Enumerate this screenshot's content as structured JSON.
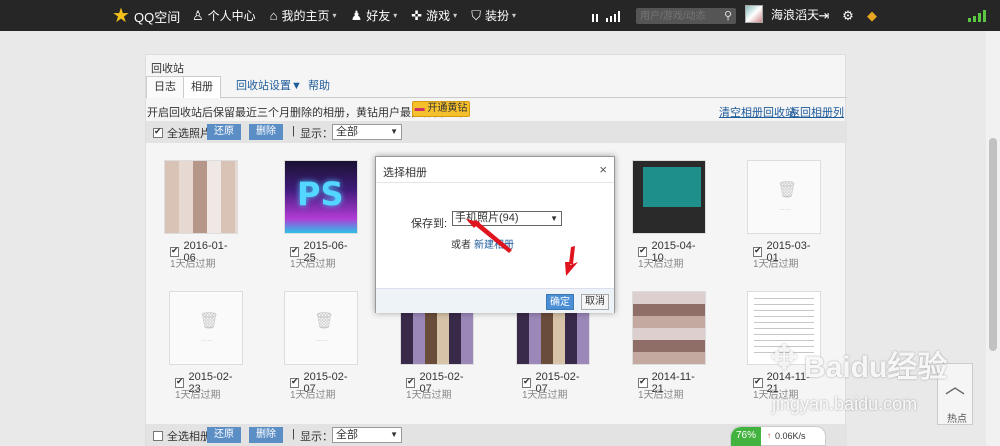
{
  "topbar": {
    "logo_text": "QQ空间",
    "nav": [
      {
        "label": "个人中心",
        "icon": "person-icon",
        "caret": false
      },
      {
        "label": "我的主页",
        "icon": "home-icon",
        "caret": true
      },
      {
        "label": "好友",
        "icon": "friends-icon",
        "caret": true
      },
      {
        "label": "游戏",
        "icon": "gamepad-icon",
        "caret": true
      },
      {
        "label": "装扮",
        "icon": "shirt-icon",
        "caret": true
      }
    ],
    "search_placeholder": "用户/游戏/动态",
    "username": "海浪滔天",
    "caret": "▾"
  },
  "panel": {
    "title": "回收站",
    "tabs": [
      "日志",
      "相册",
      "回收站设置▼",
      "帮助"
    ],
    "info_text": "开启回收站后保留最近三个月删除的相册，黄钻用户最多保留一年",
    "vip_button": "开通黄钻",
    "clear_link": "清空相册回收站",
    "back_link": "返回相册列表"
  },
  "toolbar": {
    "select_all_photos": "全选照片",
    "restore": "还原",
    "delete": "删除",
    "display_label": "显示：",
    "display_value": "全部"
  },
  "toolbar_bottom": {
    "select_all_albums": "全选相册",
    "restore": "还原",
    "delete": "删除",
    "display_label": "显示：",
    "display_value": "全部"
  },
  "photos": [
    {
      "date": "2016-01-06",
      "expire": "1天后过期"
    },
    {
      "date": "2015-06-25",
      "expire": "1天后过期"
    },
    {
      "date": "2015-04-10",
      "expire": "1天后过期"
    },
    {
      "date": "2015-03-01",
      "expire": "1天后过期"
    },
    {
      "date": "2015-02-23",
      "expire": "1天后过期"
    },
    {
      "date": "2015-02-07",
      "expire": "1天后过期"
    },
    {
      "date": "2015-02-07",
      "expire": "1天后过期"
    },
    {
      "date": "2015-02-07",
      "expire": "1天后过期"
    },
    {
      "date": "2014-11-21",
      "expire": "1天后过期"
    },
    {
      "date": "2014-11-21",
      "expire": "1天后过期"
    }
  ],
  "dialog": {
    "title": "选择相册",
    "close": "×",
    "save_label": "保存到:",
    "save_value": "手机照片(94)",
    "or_text": "或者",
    "new_album": "新建相册",
    "ok": "确定",
    "cancel": "取消"
  },
  "widgets": {
    "hot_label": "热点",
    "percent": "76%",
    "net_speed": "0.06K/s"
  },
  "watermark": {
    "brand": "Baidu经验",
    "url": "jingyan.baidu.com"
  },
  "colors": {
    "topbar": "#262626",
    "accent_blue": "#5b8ec5",
    "vip_yellow": "#f6c02d",
    "annotation_red": "#e0141e"
  }
}
